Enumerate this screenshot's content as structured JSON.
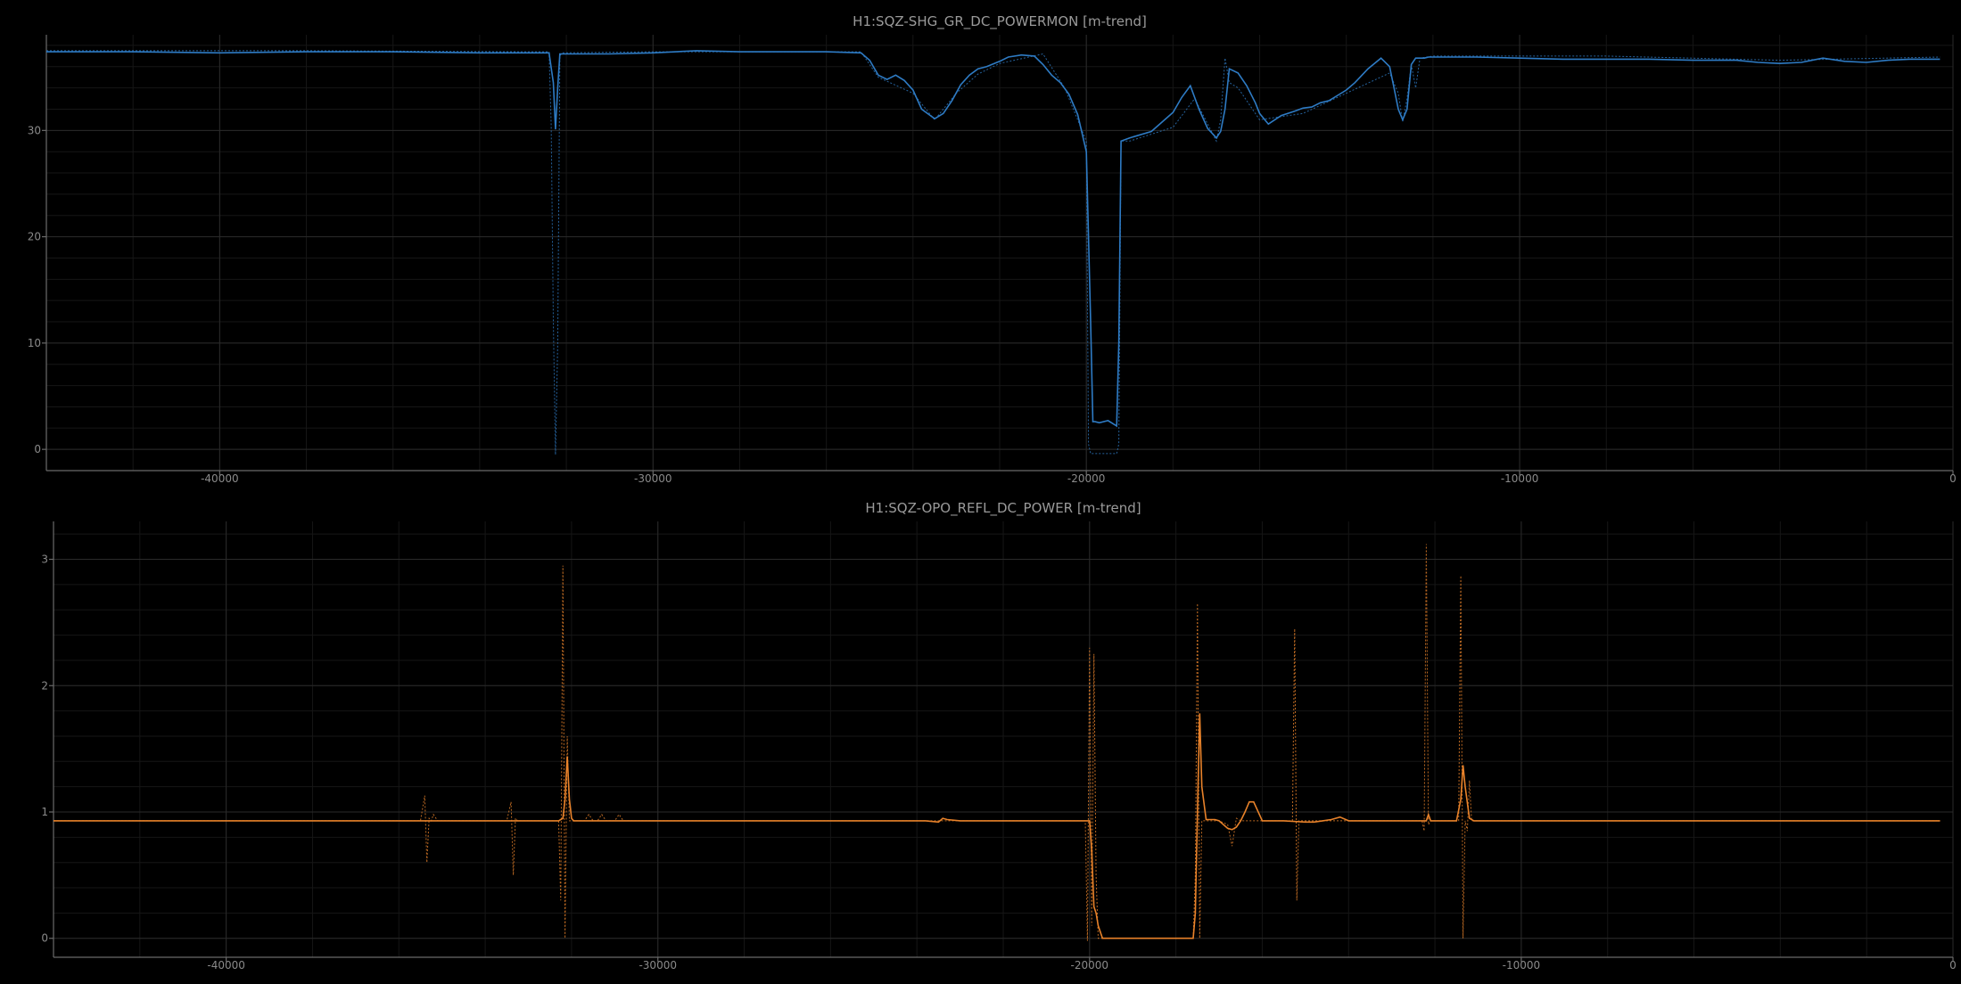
{
  "chart_data": [
    {
      "type": "line",
      "title": "H1:SQZ-SHG_GR_DC_POWERMON [m-trend]",
      "xlim": [
        -44000,
        0
      ],
      "ylim": [
        -2,
        39
      ],
      "xticks": [
        -40000,
        -30000,
        -20000,
        -10000,
        0
      ],
      "xtick_labels": [
        "-40000",
        "-30000",
        "-20000",
        "-10000",
        "0"
      ],
      "yticks": [
        0,
        10,
        20,
        30
      ],
      "ytick_labels": [
        "0",
        "10",
        "20",
        "30"
      ],
      "grid": true,
      "color": "#2e7bc4",
      "series": [
        {
          "style": "solid",
          "x": [
            -44000,
            -42000,
            -40000,
            -38000,
            -36000,
            -34000,
            -33000,
            -32400,
            -32300,
            -32250,
            -32200,
            -32150,
            -32000,
            -31000,
            -30000,
            -29000,
            -28000,
            -27000,
            -26000,
            -25200,
            -25000,
            -24800,
            -24600,
            -24400,
            -24200,
            -24000,
            -23800,
            -23500,
            -23300,
            -23100,
            -22900,
            -22700,
            -22500,
            -22300,
            -22000,
            -21800,
            -21500,
            -21200,
            -21000,
            -20800,
            -20600,
            -20400,
            -20200,
            -20000,
            -19900,
            -19850,
            -19800,
            -19700,
            -19500,
            -19300,
            -19250,
            -19200,
            -19000,
            -18500,
            -18000,
            -17800,
            -17600,
            -17400,
            -17200,
            -17000,
            -16900,
            -16800,
            -16700,
            -16500,
            -16300,
            -16100,
            -16000,
            -15800,
            -15500,
            -15200,
            -15000,
            -14800,
            -14600,
            -14400,
            -14200,
            -14000,
            -13800,
            -13500,
            -13200,
            -13000,
            -12900,
            -12800,
            -12700,
            -12600,
            -12500,
            -12400,
            -12300,
            -12200,
            -12100,
            -12000,
            -11500,
            -11000,
            -10000,
            -9000,
            -8000,
            -7000,
            -6000,
            -5000,
            -4500,
            -4000,
            -3500,
            -3000,
            -2500,
            -2000,
            -1500,
            -1000,
            -500,
            -300
          ],
          "y": [
            37.4,
            37.4,
            37.3,
            37.4,
            37.4,
            37.3,
            37.3,
            37.3,
            34.5,
            30.1,
            34.0,
            37.2,
            37.2,
            37.2,
            37.3,
            37.5,
            37.4,
            37.4,
            37.4,
            37.3,
            36.6,
            35.2,
            34.8,
            35.2,
            34.7,
            33.8,
            32.0,
            31.1,
            31.6,
            32.8,
            34.3,
            35.2,
            35.8,
            36.0,
            36.5,
            36.9,
            37.1,
            37.0,
            36.2,
            35.2,
            34.5,
            33.4,
            31.5,
            28.0,
            12.0,
            2.6,
            2.6,
            2.5,
            2.7,
            2.2,
            10.0,
            29.0,
            29.3,
            29.9,
            31.7,
            33.1,
            34.2,
            32.0,
            30.2,
            29.3,
            29.9,
            32.0,
            35.8,
            35.4,
            34.2,
            32.6,
            31.6,
            30.6,
            31.4,
            31.8,
            32.1,
            32.2,
            32.6,
            32.8,
            33.3,
            33.8,
            34.5,
            35.8,
            36.8,
            36.0,
            34.0,
            32.0,
            31.0,
            32.0,
            36.2,
            36.8,
            36.8,
            36.8,
            36.9,
            36.9,
            36.9,
            36.9,
            36.8,
            36.7,
            36.7,
            36.7,
            36.6,
            36.6,
            36.4,
            36.3,
            36.4,
            36.8,
            36.5,
            36.4,
            36.6,
            36.7,
            36.7,
            36.7
          ]
        },
        {
          "style": "dotted",
          "x": [
            -44000,
            -38000,
            -33000,
            -32400,
            -32350,
            -32300,
            -32250,
            -32200,
            -32150,
            -32100,
            -30000,
            -25200,
            -24800,
            -24000,
            -23500,
            -23000,
            -22500,
            -22000,
            -21000,
            -20500,
            -20000,
            -19950,
            -19900,
            -19800,
            -19500,
            -19300,
            -19250,
            -19200,
            -19000,
            -18000,
            -17500,
            -17000,
            -16900,
            -16800,
            -16700,
            -16500,
            -16000,
            -15000,
            -14000,
            -13000,
            -12800,
            -12700,
            -12600,
            -12500,
            -12400,
            -12300,
            -12000,
            -8000,
            -4000,
            -300
          ],
          "y": [
            37.5,
            37.5,
            37.4,
            37.4,
            30.5,
            12.0,
            -0.5,
            10.0,
            37.0,
            37.3,
            37.4,
            37.4,
            35.0,
            33.5,
            31.0,
            33.5,
            35.3,
            36.3,
            37.2,
            34.0,
            29.0,
            0.5,
            -0.4,
            -0.4,
            -0.4,
            -0.4,
            0.5,
            29.0,
            29.0,
            30.3,
            33.0,
            29.0,
            31.0,
            36.8,
            34.5,
            34.0,
            31.0,
            31.6,
            33.5,
            35.4,
            33.5,
            30.8,
            33.0,
            36.2,
            34.0,
            36.8,
            37.0,
            37.0,
            36.6,
            36.9
          ]
        }
      ]
    },
    {
      "type": "line",
      "title": "H1:SQZ-OPO_REFL_DC_POWER [m-trend]",
      "xlim": [
        -44000,
        0
      ],
      "ylim": [
        -0.15,
        3.3
      ],
      "xticks": [
        -40000,
        -30000,
        -20000,
        -10000,
        0
      ],
      "xtick_labels": [
        "-40000",
        "-30000",
        "-20000",
        "-10000",
        "0"
      ],
      "yticks": [
        0,
        1,
        2,
        3
      ],
      "ytick_labels": [
        "0",
        "1",
        "2",
        "3"
      ],
      "grid": true,
      "color": "#e8822a",
      "series": [
        {
          "style": "solid",
          "x": [
            -44000,
            -40000,
            -36000,
            -33000,
            -32300,
            -32200,
            -32150,
            -32100,
            -32050,
            -32000,
            -31950,
            -31500,
            -31000,
            -30000,
            -28000,
            -26000,
            -24000,
            -23800,
            -23500,
            -23400,
            -23300,
            -23000,
            -22000,
            -21000,
            -20100,
            -20000,
            -19950,
            -19900,
            -19850,
            -19800,
            -19700,
            -19600,
            -19500,
            -19000,
            -18500,
            -18000,
            -17700,
            -17600,
            -17550,
            -17500,
            -17450,
            -17400,
            -17300,
            -17100,
            -17000,
            -16900,
            -16800,
            -16700,
            -16600,
            -16500,
            -16400,
            -16300,
            -16200,
            -16000,
            -15500,
            -15000,
            -14800,
            -14600,
            -14400,
            -14200,
            -14000,
            -13500,
            -13000,
            -12500,
            -12300,
            -12200,
            -12150,
            -12100,
            -12000,
            -11500,
            -11400,
            -11350,
            -11300,
            -11200,
            -11100,
            -11000,
            -10500,
            -10000,
            -8000,
            -6000,
            -4000,
            -2000,
            -300
          ],
          "y": [
            0.93,
            0.93,
            0.93,
            0.93,
            0.93,
            0.95,
            1.1,
            1.44,
            1.1,
            0.95,
            0.93,
            0.93,
            0.93,
            0.93,
            0.93,
            0.93,
            0.93,
            0.93,
            0.92,
            0.95,
            0.94,
            0.93,
            0.93,
            0.93,
            0.93,
            0.93,
            0.7,
            0.25,
            0.2,
            0.1,
            0.0,
            0.0,
            0.0,
            0.0,
            0.0,
            0.0,
            0.0,
            0.0,
            0.2,
            1.0,
            1.78,
            1.2,
            0.94,
            0.94,
            0.93,
            0.9,
            0.87,
            0.86,
            0.88,
            0.93,
            1.0,
            1.08,
            1.08,
            0.93,
            0.93,
            0.92,
            0.92,
            0.93,
            0.94,
            0.96,
            0.93,
            0.93,
            0.93,
            0.93,
            0.93,
            0.93,
            0.98,
            0.93,
            0.93,
            0.93,
            1.1,
            1.37,
            1.2,
            0.95,
            0.93,
            0.93,
            0.93,
            0.93,
            0.93,
            0.93,
            0.93,
            0.93,
            0.93
          ]
        },
        {
          "style": "dotted",
          "x": [
            -44000,
            -35500,
            -35400,
            -35350,
            -35300,
            -35250,
            -35200,
            -35100,
            -35000,
            -34000,
            -33500,
            -33400,
            -33350,
            -33300,
            -33250,
            -33200,
            -33000,
            -32500,
            -32300,
            -32250,
            -32200,
            -32150,
            -32100,
            -32050,
            -32000,
            -31900,
            -31700,
            -31600,
            -31500,
            -31400,
            -31300,
            -31200,
            -31100,
            -31000,
            -30900,
            -30800,
            -29000,
            -26000,
            -24000,
            -22000,
            -20500,
            -20100,
            -20050,
            -20000,
            -19950,
            -19900,
            -19850,
            -19800,
            -19700,
            -19600,
            -19000,
            -18000,
            -17800,
            -17600,
            -17550,
            -17500,
            -17450,
            -17400,
            -17000,
            -16800,
            -16700,
            -16600,
            -16500,
            -15500,
            -15300,
            -15250,
            -15200,
            -15150,
            -15100,
            -15000,
            -14000,
            -13000,
            -12500,
            -12300,
            -12250,
            -12200,
            -12150,
            -12100,
            -12050,
            -12000,
            -11500,
            -11450,
            -11400,
            -11350,
            -11300,
            -11250,
            -11200,
            -11150,
            -11100,
            -11000,
            -10500,
            -8000,
            -4000,
            -300
          ],
          "y": [
            0.93,
            0.93,
            1.13,
            0.6,
            0.95,
            0.93,
            0.98,
            0.93,
            0.93,
            0.93,
            0.93,
            1.08,
            0.5,
            0.95,
            0.93,
            0.93,
            0.93,
            0.93,
            0.93,
            0.3,
            2.95,
            0.0,
            1.6,
            0.93,
            0.93,
            0.93,
            0.93,
            0.98,
            0.93,
            0.93,
            0.98,
            0.93,
            0.93,
            0.93,
            0.98,
            0.93,
            0.93,
            0.93,
            0.93,
            0.93,
            0.93,
            0.93,
            -0.02,
            2.3,
            0.1,
            2.25,
            0.5,
            0.0,
            0.0,
            0.0,
            0.0,
            0.0,
            0.0,
            0.0,
            0.5,
            2.65,
            0.0,
            0.93,
            0.93,
            0.9,
            0.73,
            0.95,
            0.93,
            0.93,
            0.93,
            2.45,
            0.3,
            0.93,
            0.93,
            0.93,
            0.93,
            0.93,
            0.93,
            0.93,
            0.85,
            3.12,
            0.9,
            0.93,
            0.93,
            0.93,
            0.93,
            0.93,
            2.87,
            0.0,
            0.93,
            0.85,
            1.25,
            0.93,
            0.93,
            0.93,
            0.93,
            0.93,
            0.93,
            0.93
          ]
        }
      ]
    }
  ]
}
